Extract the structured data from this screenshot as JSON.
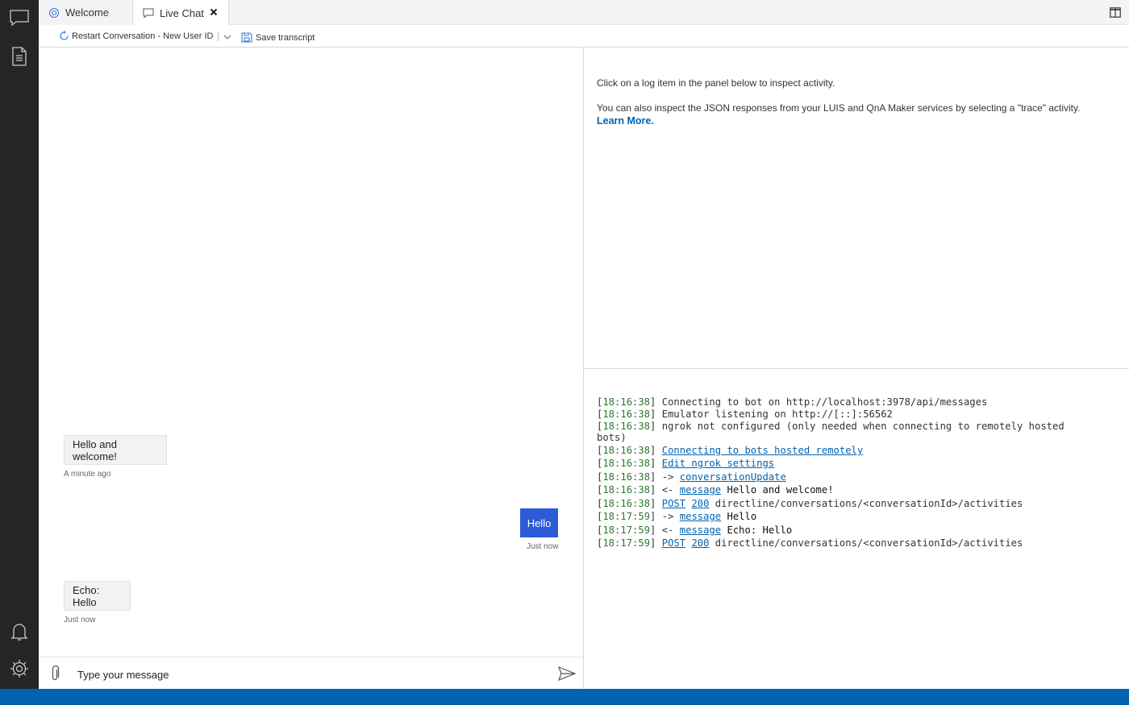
{
  "tabs": {
    "welcome": {
      "label": "Welcome",
      "icon": "bot-icon"
    },
    "live_chat": {
      "label": "Live Chat",
      "icon": "chat-icon"
    }
  },
  "toolbar": {
    "restart_label": "Restart Conversation - New User ID",
    "save_label": "Save transcript"
  },
  "chat": {
    "messages": [
      {
        "from": "bot",
        "text": "Hello and welcome!",
        "time": "A minute ago"
      },
      {
        "from": "user",
        "text": "Hello",
        "time": "Just now"
      },
      {
        "from": "bot",
        "text": "Echo: Hello",
        "time": "Just now"
      }
    ],
    "input_placeholder": "Type your message",
    "accent": "#2b5bd6"
  },
  "inspector": {
    "line1": "Click on a log item in the panel below to inspect activity.",
    "line2": "You can also inspect the JSON responses from your LUIS and QnA Maker services by selecting a \"trace\" activity.",
    "learn_more": "Learn More."
  },
  "log": {
    "rows": [
      {
        "time": "18:16:38",
        "text": "Connecting to bot on http://localhost:3978/api/messages"
      },
      {
        "time": "18:16:38",
        "text": "Emulator listening on http://[::]:56562"
      },
      {
        "time": "18:16:38",
        "text": "ngrok not configured (only needed when connecting to remotely hosted",
        "text2": "bots)"
      },
      {
        "time": "18:16:38",
        "link": "Connecting to bots hosted remotely"
      },
      {
        "time": "18:16:38",
        "link": "Edit ngrok settings"
      },
      {
        "time": "18:16:38",
        "arrow": "->",
        "link": "conversationUpdate"
      },
      {
        "time": "18:16:38",
        "arrow": "<-",
        "link": "message",
        "text": "Hello and welcome!"
      },
      {
        "time": "18:16:38",
        "link": "POST",
        "link2": "200",
        "text": "directline/conversations/<conversationId>/activities"
      },
      {
        "time": "18:17:59",
        "arrow": "->",
        "link": "message",
        "text": "Hello"
      },
      {
        "time": "18:17:59",
        "arrow": "<-",
        "link": "message",
        "text": "Echo: Hello"
      },
      {
        "time": "18:17:59",
        "link": "POST",
        "link2": "200",
        "text": "directline/conversations/<conversationId>/activities"
      }
    ]
  },
  "colors": {
    "activity_bar": "#252526",
    "status_bar": "#0063b1",
    "link": "#0063b1",
    "timestamp": "#2c7a2c"
  }
}
